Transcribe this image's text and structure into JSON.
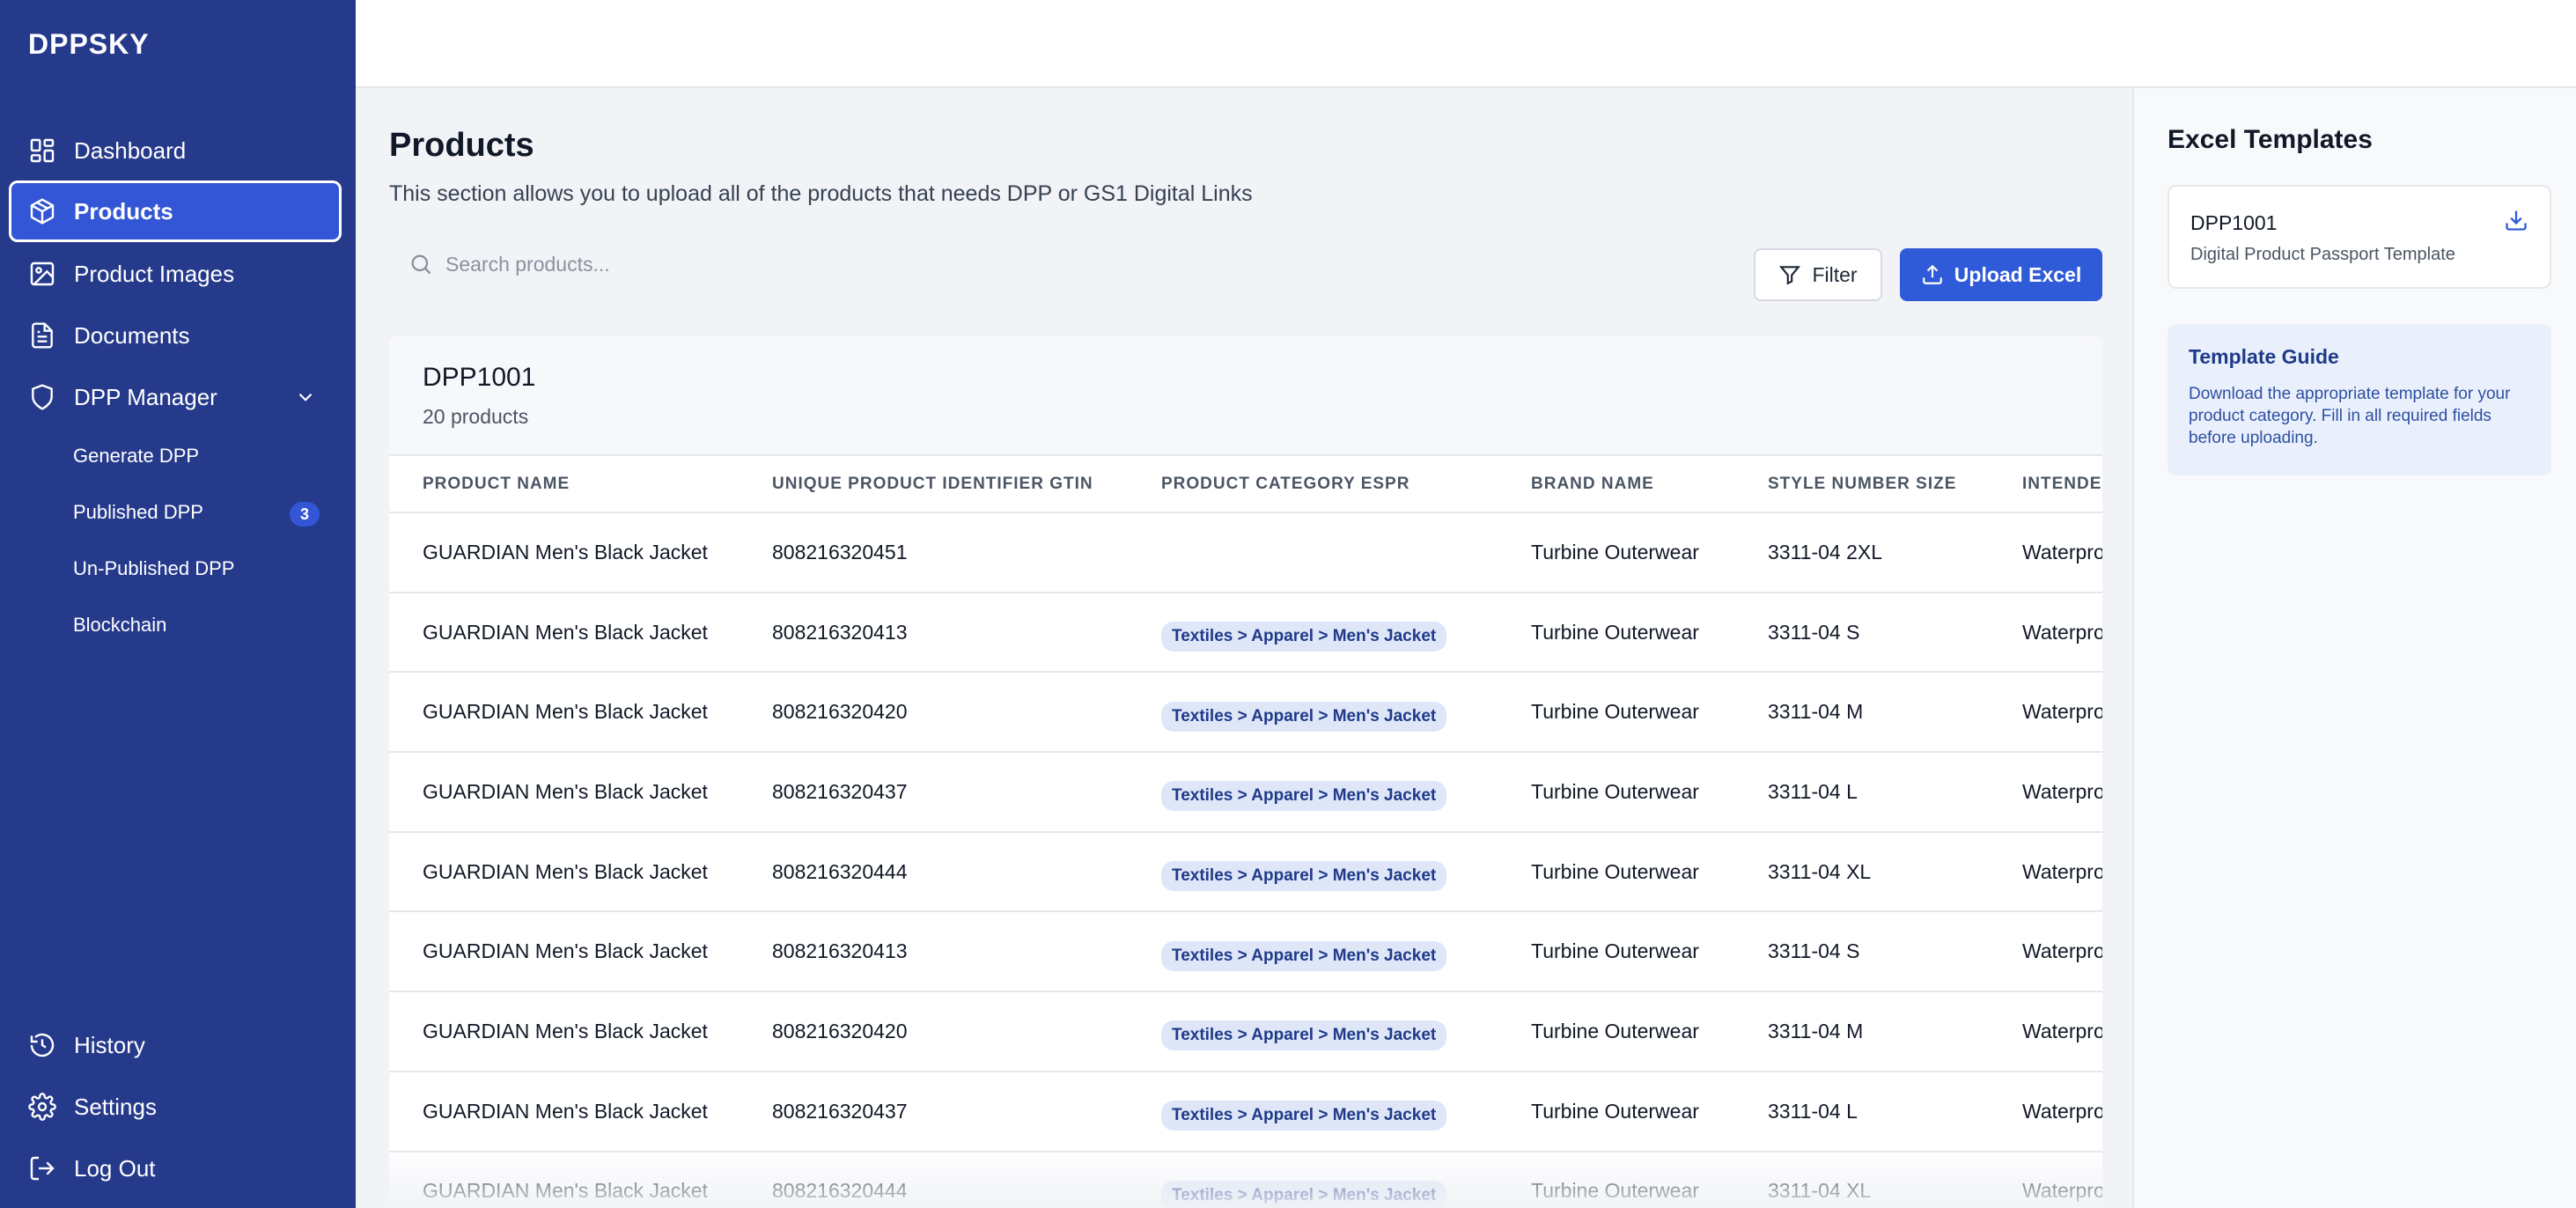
{
  "app": {
    "brand": "DPPSKY"
  },
  "sidebar": {
    "items": [
      {
        "label": "Dashboard",
        "icon": "dashboard-icon"
      },
      {
        "label": "Products",
        "icon": "box-icon",
        "active": true
      },
      {
        "label": "Product Images",
        "icon": "image-icon"
      },
      {
        "label": "Documents",
        "icon": "document-icon"
      },
      {
        "label": "DPP Manager",
        "icon": "shield-icon",
        "expanded": true
      }
    ],
    "sub_items": [
      {
        "label": "Generate DPP"
      },
      {
        "label": "Published DPP",
        "badge": "3"
      },
      {
        "label": "Un-Published DPP"
      },
      {
        "label": "Blockchain"
      }
    ],
    "bottom_items": [
      {
        "label": "History",
        "icon": "history-icon"
      },
      {
        "label": "Settings",
        "icon": "gear-icon"
      },
      {
        "label": "Log Out",
        "icon": "logout-icon"
      }
    ]
  },
  "main": {
    "title": "Products",
    "description": "This section allows you to upload all of the products that needs DPP or GS1 Digital Links",
    "search": {
      "placeholder": "Search products..."
    },
    "filter_label": "Filter",
    "upload_label": "Upload Excel",
    "table_card": {
      "title": "DPP1001",
      "subtitle": "20 products",
      "columns": [
        "PRODUCT NAME",
        "UNIQUE PRODUCT IDENTIFIER GTIN",
        "PRODUCT CATEGORY ESPR",
        "BRAND NAME",
        "STYLE NUMBER SIZE",
        "INTENDED USE"
      ],
      "rows": [
        [
          "GUARDIAN Men's Black Jacket",
          "808216320451",
          "",
          "Turbine Outerwear",
          "3311-04 2XL",
          "Waterproof"
        ],
        [
          "GUARDIAN Men's Black Jacket",
          "808216320413",
          "Textiles > Apparel > Men's Jacket",
          "Turbine Outerwear",
          "3311-04 S",
          "Waterproof"
        ],
        [
          "GUARDIAN Men's Black Jacket",
          "808216320420",
          "Textiles > Apparel > Men's Jacket",
          "Turbine Outerwear",
          "3311-04 M",
          "Waterproof"
        ],
        [
          "GUARDIAN Men's Black Jacket",
          "808216320437",
          "Textiles > Apparel > Men's Jacket",
          "Turbine Outerwear",
          "3311-04 L",
          "Waterproof"
        ],
        [
          "GUARDIAN Men's Black Jacket",
          "808216320444",
          "Textiles > Apparel > Men's Jacket",
          "Turbine Outerwear",
          "3311-04 XL",
          "Waterproof"
        ],
        [
          "GUARDIAN Men's Black Jacket",
          "808216320413",
          "Textiles > Apparel > Men's Jacket",
          "Turbine Outerwear",
          "3311-04 S",
          "Waterproof"
        ],
        [
          "GUARDIAN Men's Black Jacket",
          "808216320420",
          "Textiles > Apparel > Men's Jacket",
          "Turbine Outerwear",
          "3311-04 M",
          "Waterproof"
        ],
        [
          "GUARDIAN Men's Black Jacket",
          "808216320437",
          "Textiles > Apparel > Men's Jacket",
          "Turbine Outerwear",
          "3311-04 L",
          "Waterproof"
        ],
        [
          "GUARDIAN Men's Black Jacket",
          "808216320444",
          "Textiles > Apparel > Men's Jacket",
          "Turbine Outerwear",
          "3311-04 XL",
          "Waterproof"
        ]
      ]
    }
  },
  "right_panel": {
    "title": "Excel Templates",
    "template": {
      "name": "DPP1001",
      "description": "Digital Product Passport Template"
    },
    "guide": {
      "title": "Template Guide",
      "text": "Download the appropriate template for your product category. Fill in all required fields before uploading."
    }
  },
  "colors": {
    "sidebar": "#263a8c",
    "accent": "#2f5bd9",
    "chip_bg": "#dfe6f7",
    "chip_text": "#1e3a8a"
  }
}
